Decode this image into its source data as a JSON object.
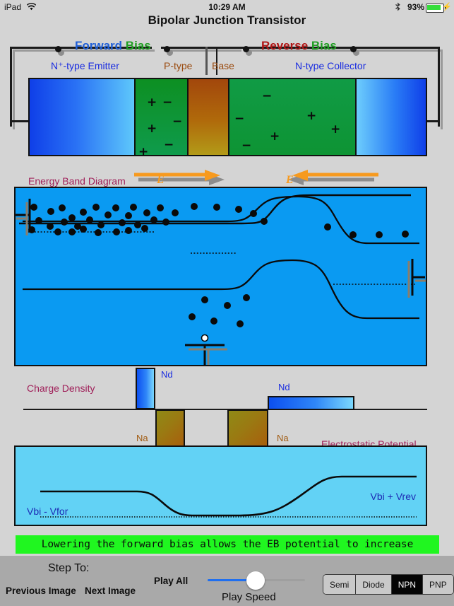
{
  "statusbar": {
    "device": "iPad",
    "wifi_icon": "wifi-icon",
    "time": "10:29 AM",
    "bluetooth_icon": "bluetooth-icon",
    "battery_percent": "93%",
    "charging_icon": "lightning-bolt-icon"
  },
  "title": "Bipolar Junction Transistor",
  "device_diagram": {
    "forward_word": "Forward",
    "bias_word_left": "Bias",
    "reverse_word": "Reverse",
    "bias_word_right": "Bias",
    "emitter_label": "N⁺-type Emitter",
    "ptype_label": "P-type",
    "base_label": "Base",
    "collector_label": "N-type Collector",
    "colors": {
      "forward": "#1f5fd8",
      "reverse": "#b01414",
      "bias": "#1f9e22",
      "region_label": "#1a2de0",
      "base_label": "#9a4b10"
    },
    "charges_base_depletion": [
      "+",
      "−",
      "+",
      "−",
      "−",
      "+"
    ],
    "charges_collector_depletion": [
      "−",
      "−",
      "+",
      "+",
      "+",
      "−"
    ]
  },
  "energy_band": {
    "label": "Energy Band Diagram",
    "field_symbol_left": "E",
    "field_symbol_right": "E"
  },
  "charge_density": {
    "label": "Charge Density",
    "nd_left": "Nd",
    "nd_right": "Nd",
    "na_left": "Na",
    "na_right": "Na"
  },
  "potential": {
    "label": "Electrostatic Potential",
    "left_value": "Vbi - Vfor",
    "right_value": "Vbi + Vrev"
  },
  "message": "Lowering the forward bias allows the EB potential to increase",
  "toolbar": {
    "step_to": "Step To:",
    "previous_image": "Previous Image",
    "next_image": "Next Image",
    "play_all": "Play All",
    "play_speed": "Play Speed",
    "segments": [
      {
        "label": "Semi",
        "selected": false
      },
      {
        "label": "Diode",
        "selected": false
      },
      {
        "label": "NPN",
        "selected": true
      },
      {
        "label": "PNP",
        "selected": false
      }
    ]
  }
}
